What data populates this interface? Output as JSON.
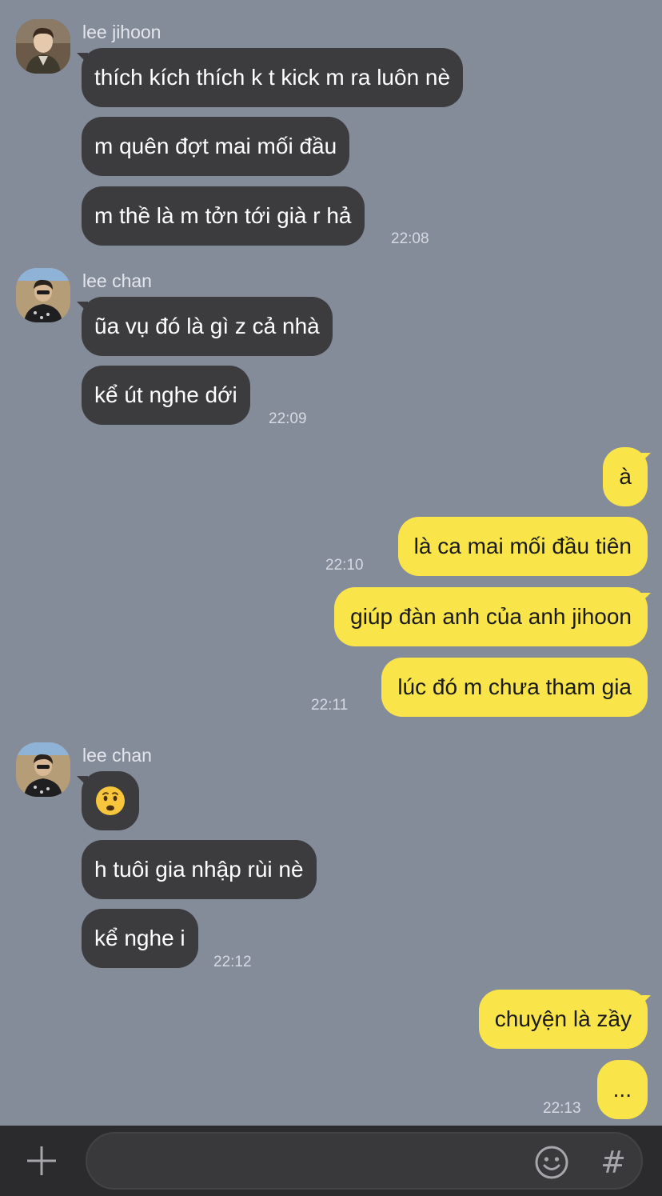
{
  "colors": {
    "background": "#848b99",
    "incoming_bubble": "#3c3c3f",
    "outgoing_bubble": "#f9e54a",
    "bottom_bar": "#2b2b2d"
  },
  "groups": [
    {
      "sender": "lee jihoon",
      "avatar": "lee-jihoon-avatar",
      "messages": [
        "thích kích thích k t kick m ra luôn nè",
        "m quên đợt mai mối đầu",
        "m thề là m tởn tới già r hả"
      ],
      "time": "22:08"
    },
    {
      "sender": "lee chan",
      "avatar": "lee-chan-avatar",
      "messages": [
        "ũa vụ đó là gì z cả nhà",
        "kể út nghe dới"
      ],
      "time": "22:09"
    },
    {
      "sender": "lee chan",
      "avatar": "lee-chan-avatar",
      "messages": [
        "h tuôi gia nhập rùi nè",
        "kể nghe i"
      ],
      "time": "22:12"
    }
  ],
  "outgoing": {
    "block1": {
      "messages": [
        "à",
        "là ca mai mối đầu tiên"
      ],
      "time": "22:10"
    },
    "block2": {
      "messages": [
        "giúp đàn anh của anh jihoon",
        "lúc đó m chưa tham gia"
      ],
      "time": "22:11"
    },
    "block3": {
      "messages": [
        "chuyện là zầy",
        "..."
      ],
      "time": "22:13"
    }
  },
  "emoji_message": "worried-face-emoji",
  "bottom_bar": {
    "plus_icon": "plus-icon",
    "emoji_icon": "smiley-icon",
    "hash_label": "#",
    "input_value": ""
  }
}
